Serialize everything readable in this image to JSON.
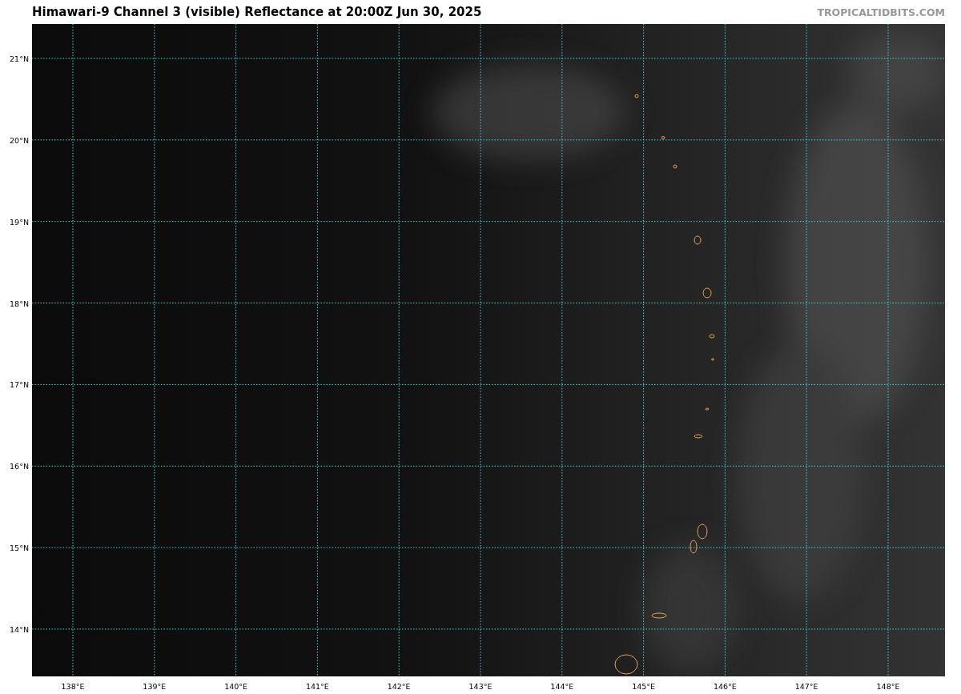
{
  "title": "Himawari-9 Channel 3 (visible) Reflectance at 20:00Z Jun 30, 2025",
  "credit": "TROPICALTIDBITS.COM",
  "map": {
    "latitude_labels": [
      "21°N",
      "20°N",
      "19°N",
      "18°N",
      "17°N",
      "16°N",
      "15°N",
      "14°N"
    ],
    "longitude_labels": [
      "138°E",
      "139°E",
      "140°E",
      "141°E",
      "142°E",
      "143°E",
      "144°E",
      "145°E",
      "146°E",
      "147°E",
      "148°E"
    ]
  }
}
